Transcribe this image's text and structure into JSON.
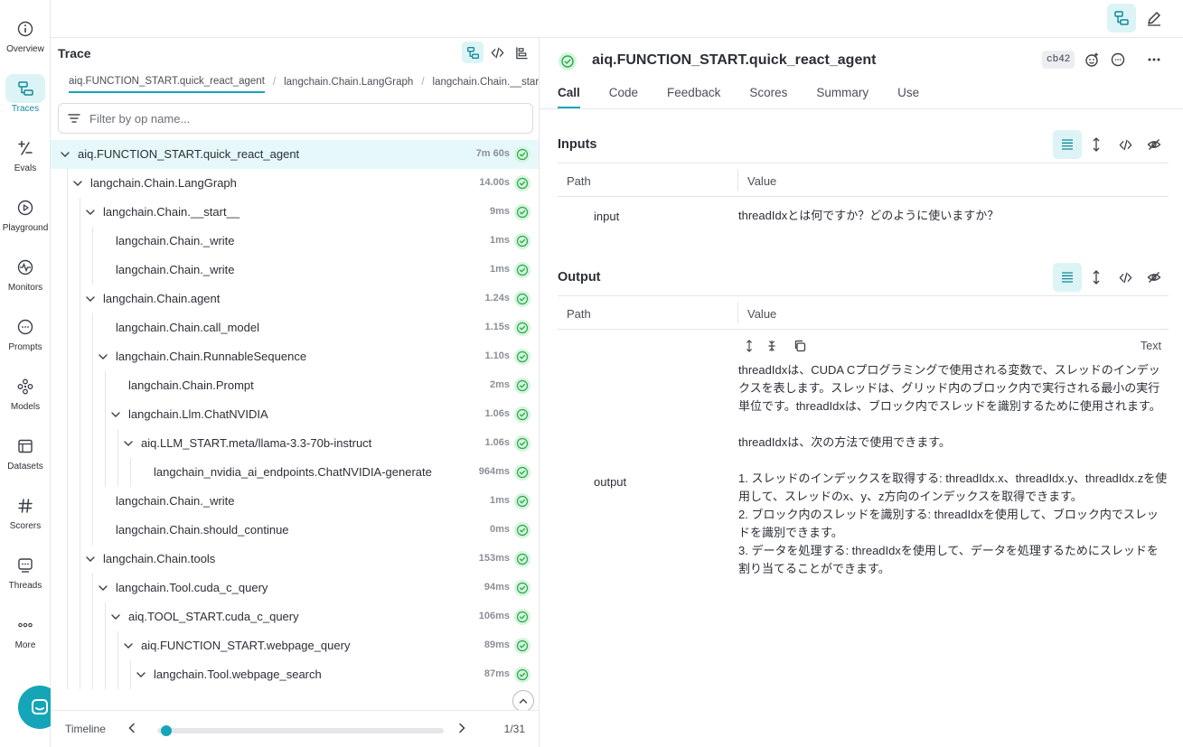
{
  "nav": {
    "items": [
      {
        "label": "Overview",
        "icon": "info-icon"
      },
      {
        "label": "Traces",
        "icon": "traces-icon",
        "active": true
      },
      {
        "label": "Evals",
        "icon": "evals-icon"
      },
      {
        "label": "Playground",
        "icon": "play-icon"
      },
      {
        "label": "Monitors",
        "icon": "monitor-icon"
      },
      {
        "label": "Prompts",
        "icon": "prompt-icon"
      },
      {
        "label": "Models",
        "icon": "models-icon"
      },
      {
        "label": "Datasets",
        "icon": "dataset-icon"
      },
      {
        "label": "Scorers",
        "icon": "hash-icon"
      },
      {
        "label": "Threads",
        "icon": "threads-icon"
      },
      {
        "label": "More",
        "icon": "more-icon"
      }
    ]
  },
  "trace_panel": {
    "title": "Trace",
    "breadcrumbs": [
      "aiq.FUNCTION_START.quick_react_agent",
      "langchain.Chain.LangGraph",
      "langchain.Chain.__start__"
    ],
    "filter_placeholder": "Filter by op name...",
    "rows": [
      {
        "label": "aiq.FUNCTION_START.quick_react_agent",
        "duration": "7m 60s",
        "depth": 0,
        "expanded": true,
        "selected": true
      },
      {
        "label": "langchain.Chain.LangGraph",
        "duration": "14.00s",
        "depth": 1,
        "expanded": true
      },
      {
        "label": "langchain.Chain.__start__",
        "duration": "9ms",
        "depth": 2,
        "expanded": true
      },
      {
        "label": "langchain.Chain._write",
        "duration": "1ms",
        "depth": 3
      },
      {
        "label": "langchain.Chain._write",
        "duration": "1ms",
        "depth": 3
      },
      {
        "label": "langchain.Chain.agent",
        "duration": "1.24s",
        "depth": 2,
        "expanded": true
      },
      {
        "label": "langchain.Chain.call_model",
        "duration": "1.15s",
        "depth": 3
      },
      {
        "label": "langchain.Chain.RunnableSequence",
        "duration": "1.10s",
        "depth": 3,
        "expanded": true
      },
      {
        "label": "langchain.Chain.Prompt",
        "duration": "2ms",
        "depth": 4
      },
      {
        "label": "langchain.Llm.ChatNVIDIA",
        "duration": "1.06s",
        "depth": 4,
        "expanded": true
      },
      {
        "label": "aiq.LLM_START.meta/llama-3.3-70b-instruct",
        "duration": "1.06s",
        "depth": 5,
        "expanded": true
      },
      {
        "label": "langchain_nvidia_ai_endpoints.ChatNVIDIA-generate",
        "duration": "964ms",
        "depth": 6
      },
      {
        "label": "langchain.Chain._write",
        "duration": "1ms",
        "depth": 3
      },
      {
        "label": "langchain.Chain.should_continue",
        "duration": "0ms",
        "depth": 3
      },
      {
        "label": "langchain.Chain.tools",
        "duration": "153ms",
        "depth": 2,
        "expanded": true
      },
      {
        "label": "langchain.Tool.cuda_c_query",
        "duration": "94ms",
        "depth": 3,
        "expanded": true
      },
      {
        "label": "aiq.TOOL_START.cuda_c_query",
        "duration": "106ms",
        "depth": 4,
        "expanded": true
      },
      {
        "label": "aiq.FUNCTION_START.webpage_query",
        "duration": "89ms",
        "depth": 5,
        "expanded": true
      },
      {
        "label": "langchain.Tool.webpage_search",
        "duration": "87ms",
        "depth": 6,
        "expanded": true
      }
    ],
    "timeline_label": "Timeline",
    "timeline_position": 0.032,
    "page_count": "1/31"
  },
  "details": {
    "title": "aiq.FUNCTION_START.quick_react_agent",
    "version": "cb42",
    "tabs": [
      "Call",
      "Code",
      "Feedback",
      "Scores",
      "Summary",
      "Use"
    ],
    "active_tab": "Call",
    "inputs": {
      "title": "Inputs",
      "col_path": "Path",
      "col_value": "Value",
      "key": "input",
      "value": "threadIdxとは何ですか？どのように使いますか？"
    },
    "output": {
      "title": "Output",
      "col_path": "Path",
      "col_value": "Value",
      "key": "output",
      "mode": "Text",
      "value": "threadIdxは、CUDA Cプログラミングで使用される変数で、スレッドのインデックスを表します。スレッドは、グリッド内のブロック内で実行される最小の実行単位です。threadIdxは、ブロック内でスレッドを識別するために使用されます。\n\nthreadIdxは、次の方法で使用できます。\n\n1. スレッドのインデックスを取得する: threadIdx.x、threadIdx.y、threadIdx.zを使用して、スレッドのx、y、z方向のインデックスを取得できます。\n2. ブロック内のスレッドを識別する: threadIdxを使用して、ブロック内でスレッドを識別できます。\n3. データを処理する: threadIdxを使用して、データを処理するためにスレッドを割り当てることができます。"
    }
  },
  "colors": {
    "accent": "#14a6b8",
    "accent_bg": "#dcf4f6",
    "selected_row": "#e6f8fa",
    "success_bg": "#d5f5de",
    "success": "#2aa84a"
  }
}
